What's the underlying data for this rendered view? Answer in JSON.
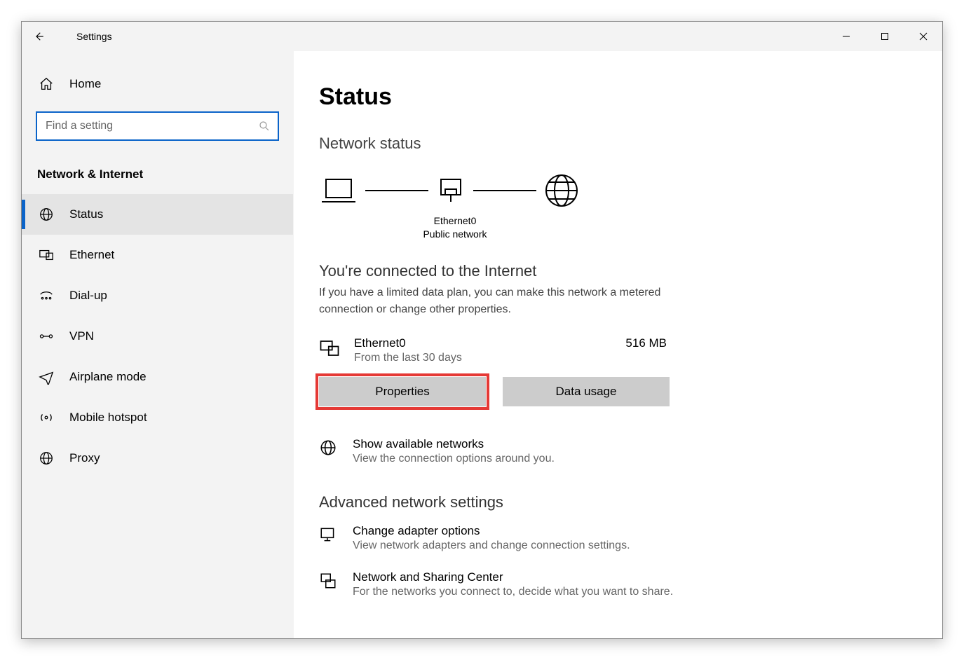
{
  "window": {
    "title": "Settings"
  },
  "sidebar": {
    "home_label": "Home",
    "search_placeholder": "Find a setting",
    "section_title": "Network & Internet",
    "items": [
      {
        "label": "Status",
        "icon": "globe-icon"
      },
      {
        "label": "Ethernet",
        "icon": "ethernet-icon"
      },
      {
        "label": "Dial-up",
        "icon": "dialup-icon"
      },
      {
        "label": "VPN",
        "icon": "vpn-icon"
      },
      {
        "label": "Airplane mode",
        "icon": "airplane-icon"
      },
      {
        "label": "Mobile hotspot",
        "icon": "hotspot-icon"
      },
      {
        "label": "Proxy",
        "icon": "proxy-icon"
      }
    ]
  },
  "main": {
    "page_title": "Status",
    "section1_title": "Network status",
    "diagram": {
      "adapter": "Ethernet0",
      "adapter_type": "Public network"
    },
    "connected_title": "You're connected to the Internet",
    "connected_sub": "If you have a limited data plan, you can make this network a metered connection or change other properties.",
    "adapter": {
      "name": "Ethernet0",
      "sub": "From the last 30 days",
      "usage": "516 MB"
    },
    "buttons": {
      "properties": "Properties",
      "data_usage": "Data usage"
    },
    "available": {
      "title": "Show available networks",
      "sub": "View the connection options around you."
    },
    "advanced_title": "Advanced network settings",
    "adapter_options": {
      "title": "Change adapter options",
      "sub": "View network adapters and change connection settings."
    },
    "sharing": {
      "title": "Network and Sharing Center",
      "sub": "For the networks you connect to, decide what you want to share."
    }
  }
}
